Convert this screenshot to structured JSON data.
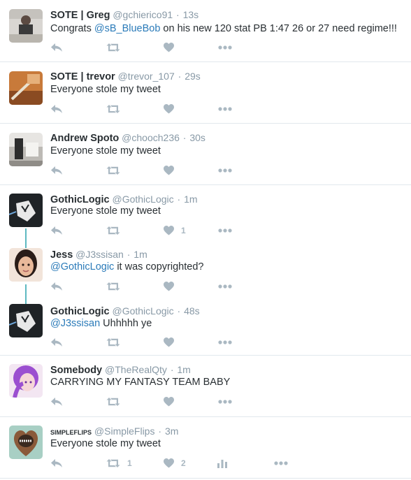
{
  "tweets": [
    {
      "name": "SOTE | Greg",
      "handle": "@gchierico91",
      "time": "13s",
      "text_pre": "Congrats ",
      "mention": "@sB_BlueBob",
      "text_post": " on his new 120 stat PB 1:47 26 or 27 need regime!!!",
      "retweets": "",
      "likes": ""
    },
    {
      "name": "SOTE | trevor",
      "handle": "@trevor_107",
      "time": "29s",
      "text_pre": "Everyone stole my tweet",
      "mention": "",
      "text_post": "",
      "retweets": "",
      "likes": ""
    },
    {
      "name": "Andrew Spoto",
      "handle": "@chooch236",
      "time": "30s",
      "text_pre": "Everyone stole my tweet",
      "mention": "",
      "text_post": "",
      "retweets": "",
      "likes": ""
    },
    {
      "name": "GothicLogic",
      "handle": "@GothicLogic",
      "time": "1m",
      "text_pre": "Everyone stole my tweet",
      "mention": "",
      "text_post": "",
      "retweets": "",
      "likes": "1"
    },
    {
      "name": "Jess",
      "handle": "@J3ssisan",
      "time": "1m",
      "text_pre": "",
      "mention": "@GothicLogic",
      "text_post": " it was copyrighted?",
      "retweets": "",
      "likes": ""
    },
    {
      "name": "GothicLogic",
      "handle": "@GothicLogic",
      "time": "48s",
      "text_pre": "",
      "mention": "@J3ssisan",
      "text_post": " Uhhhhh ye",
      "retweets": "",
      "likes": ""
    },
    {
      "name": "Somebody",
      "handle": "@TheRealQty",
      "time": "1m",
      "text_pre": "CARRYING MY FANTASY TEAM BABY",
      "mention": "",
      "text_post": "",
      "retweets": "",
      "likes": ""
    },
    {
      "name": "SIMPLEFLIPS",
      "handle": "@SimpleFlips",
      "time": "3m",
      "text_pre": "Everyone stole my tweet",
      "mention": "",
      "text_post": "",
      "retweets": "1",
      "likes": "2"
    }
  ],
  "separator": "·",
  "icons": {
    "reply": "reply-icon",
    "retweet": "retweet-icon",
    "like": "heart-icon",
    "more": "more-icon",
    "analytics": "analytics-icon"
  },
  "colors": {
    "mention": "#2b7bb9",
    "muted": "#8899a6",
    "icon": "#aab8c2",
    "thread": "#5eb9c1",
    "divider": "#e1e8ed"
  }
}
